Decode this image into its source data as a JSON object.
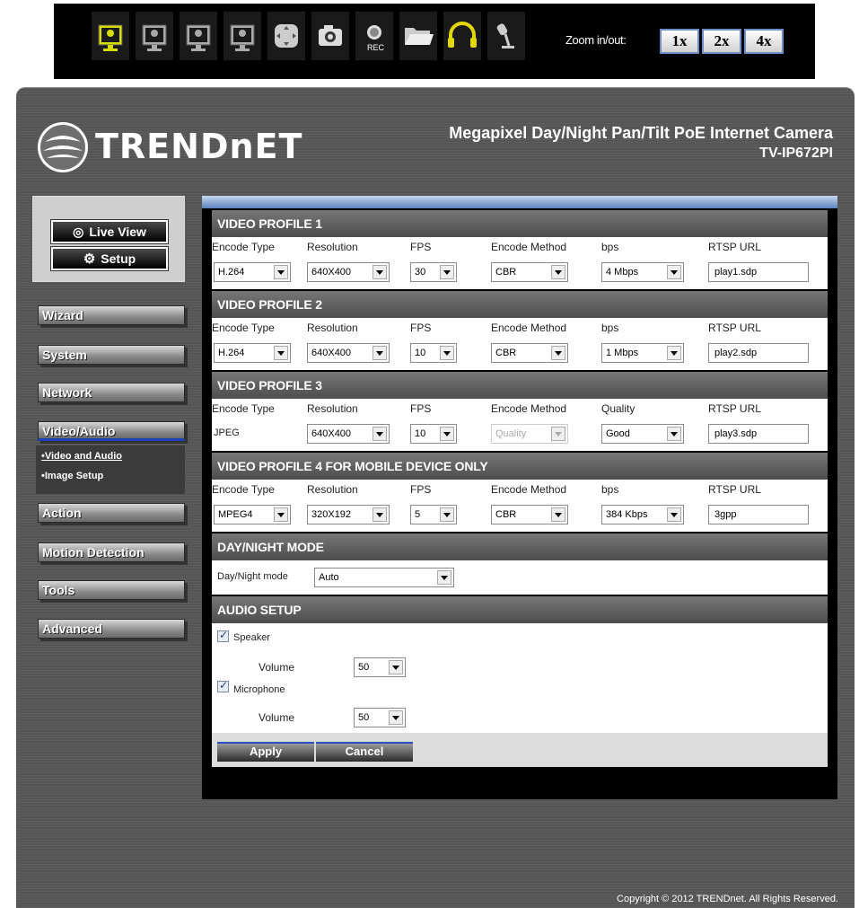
{
  "toolbar": {
    "zoom_label": "Zoom in/out:",
    "zoom_buttons": [
      "1x",
      "2x",
      "4x"
    ],
    "rec_label": "REC",
    "icons": [
      "camera-1-icon",
      "camera-2-icon",
      "camera-3-icon",
      "camera-4-icon",
      "pan-tilt-icon",
      "snapshot-icon",
      "record-icon",
      "folder-icon",
      "headphones-icon",
      "microphone-icon"
    ]
  },
  "header": {
    "logo": "TRENDnET",
    "product_title": "Megapixel Day/Night Pan/Tilt PoE Internet Camera",
    "model": "TV-IP672PI"
  },
  "sidebar": {
    "live_view": "Live View",
    "setup": "Setup",
    "nav": [
      "Wizard",
      "System",
      "Network",
      "Video/Audio",
      "Action",
      "Motion Detection",
      "Tools",
      "Advanced"
    ],
    "sub_items": [
      "•Video and Audio",
      "•Image Setup"
    ]
  },
  "profiles": [
    {
      "title": "VIDEO PROFILE 1",
      "headers": [
        "Encode Type",
        "Resolution",
        "FPS",
        "Encode Method",
        "bps",
        "RTSP URL"
      ],
      "encode_type": "H.264",
      "resolution": "640X400",
      "fps": "30",
      "encode_method": "CBR",
      "rate": "4 Mbps",
      "rtsp_url": "play1.sdp"
    },
    {
      "title": "VIDEO PROFILE 2",
      "headers": [
        "Encode Type",
        "Resolution",
        "FPS",
        "Encode Method",
        "bps",
        "RTSP URL"
      ],
      "encode_type": "H.264",
      "resolution": "640X400",
      "fps": "10",
      "encode_method": "CBR",
      "rate": "1 Mbps",
      "rtsp_url": "play2.sdp"
    },
    {
      "title": "VIDEO PROFILE 3",
      "headers": [
        "Encode Type",
        "Resolution",
        "FPS",
        "Encode Method",
        "Quality",
        "RTSP URL"
      ],
      "encode_type": "JPEG",
      "resolution": "640X400",
      "fps": "10",
      "encode_method": "Quality",
      "rate": "Good",
      "rtsp_url": "play3.sdp"
    },
    {
      "title": "VIDEO PROFILE 4 FOR MOBILE DEVICE ONLY",
      "headers": [
        "Encode Type",
        "Resolution",
        "FPS",
        "Encode Method",
        "bps",
        "RTSP URL"
      ],
      "encode_type": "MPEG4",
      "resolution": "320X192",
      "fps": "5",
      "encode_method": "CBR",
      "rate": "384 Kbps",
      "rtsp_url": "3gpp"
    }
  ],
  "day_night": {
    "title": "DAY/NIGHT MODE",
    "label": "Day/Night mode",
    "value": "Auto"
  },
  "audio": {
    "title": "AUDIO SETUP",
    "speaker_label": "Speaker",
    "speaker_volume_label": "Volume",
    "speaker_volume": "50",
    "microphone_label": "Microphone",
    "microphone_volume_label": "Volume",
    "microphone_volume": "50"
  },
  "actions": {
    "apply": "Apply",
    "cancel": "Cancel"
  },
  "footer": {
    "copyright": "Copyright © 2012 TRENDnet. All Rights Reserved."
  },
  "colors": {
    "accent": "#1c3fb8",
    "zoom_border": "#6b8fc4",
    "camera_highlight": "#c8d400"
  }
}
